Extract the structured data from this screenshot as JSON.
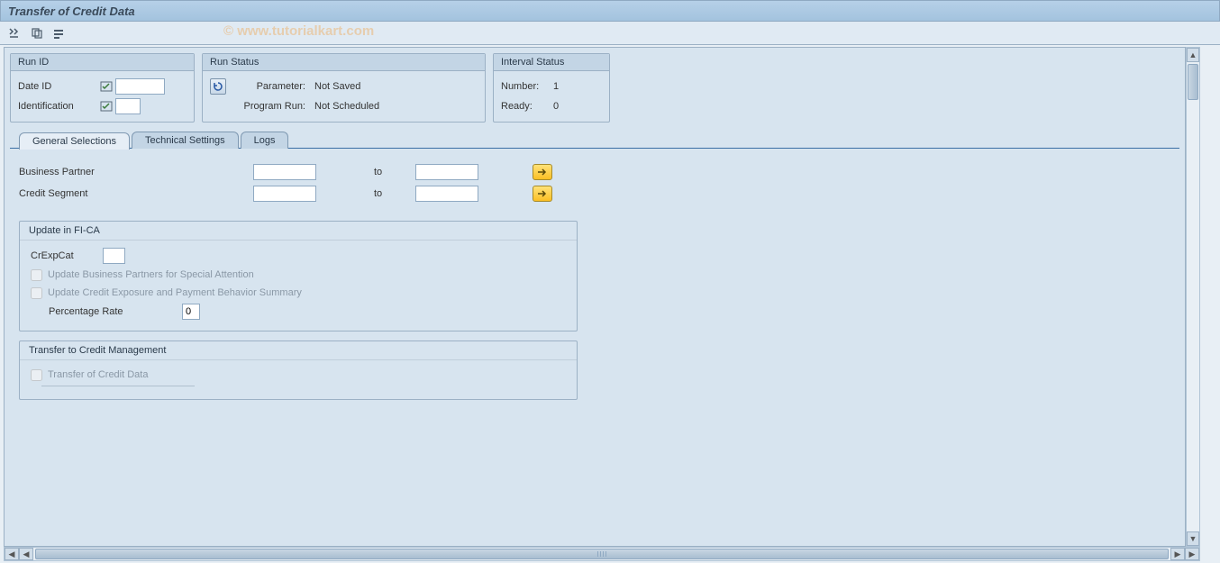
{
  "title": "Transfer of Credit Data",
  "watermark": "© www.tutorialkart.com",
  "toolbar_icons": [
    "execute-icon",
    "copy-icon",
    "variant-icon"
  ],
  "groups": {
    "run_id": {
      "title": "Run ID",
      "date_id_label": "Date ID",
      "date_id_value": "",
      "identification_label": "Identification",
      "identification_value": ""
    },
    "run_status": {
      "title": "Run Status",
      "parameter_label": "Parameter:",
      "parameter_value": "Not Saved",
      "program_run_label": "Program Run:",
      "program_run_value": "Not Scheduled"
    },
    "interval_status": {
      "title": "Interval Status",
      "number_label": "Number:",
      "number_value": "1",
      "ready_label": "Ready:",
      "ready_value": "0"
    }
  },
  "tabs": [
    {
      "label": "General Selections",
      "active": true
    },
    {
      "label": "Technical Settings",
      "active": false
    },
    {
      "label": "Logs",
      "active": false
    }
  ],
  "selections": {
    "business_partner": {
      "label": "Business Partner",
      "from": "",
      "to_label": "to",
      "to": ""
    },
    "credit_segment": {
      "label": "Credit Segment",
      "from": "",
      "to_label": "to",
      "to": ""
    }
  },
  "update_fica": {
    "title": "Update in FI-CA",
    "crexpcat_label": "CrExpCat",
    "crexpcat_value": "",
    "chk1_label": "Update Business Partners for Special Attention",
    "chk1_checked": false,
    "chk2_label": "Update Credit Exposure and Payment Behavior Summary",
    "chk2_checked": false,
    "percentage_label": "Percentage Rate",
    "percentage_value": "0"
  },
  "transfer_cm": {
    "title": "Transfer to Credit Management",
    "chk_label": "Transfer of Credit Data",
    "chk_checked": false
  }
}
